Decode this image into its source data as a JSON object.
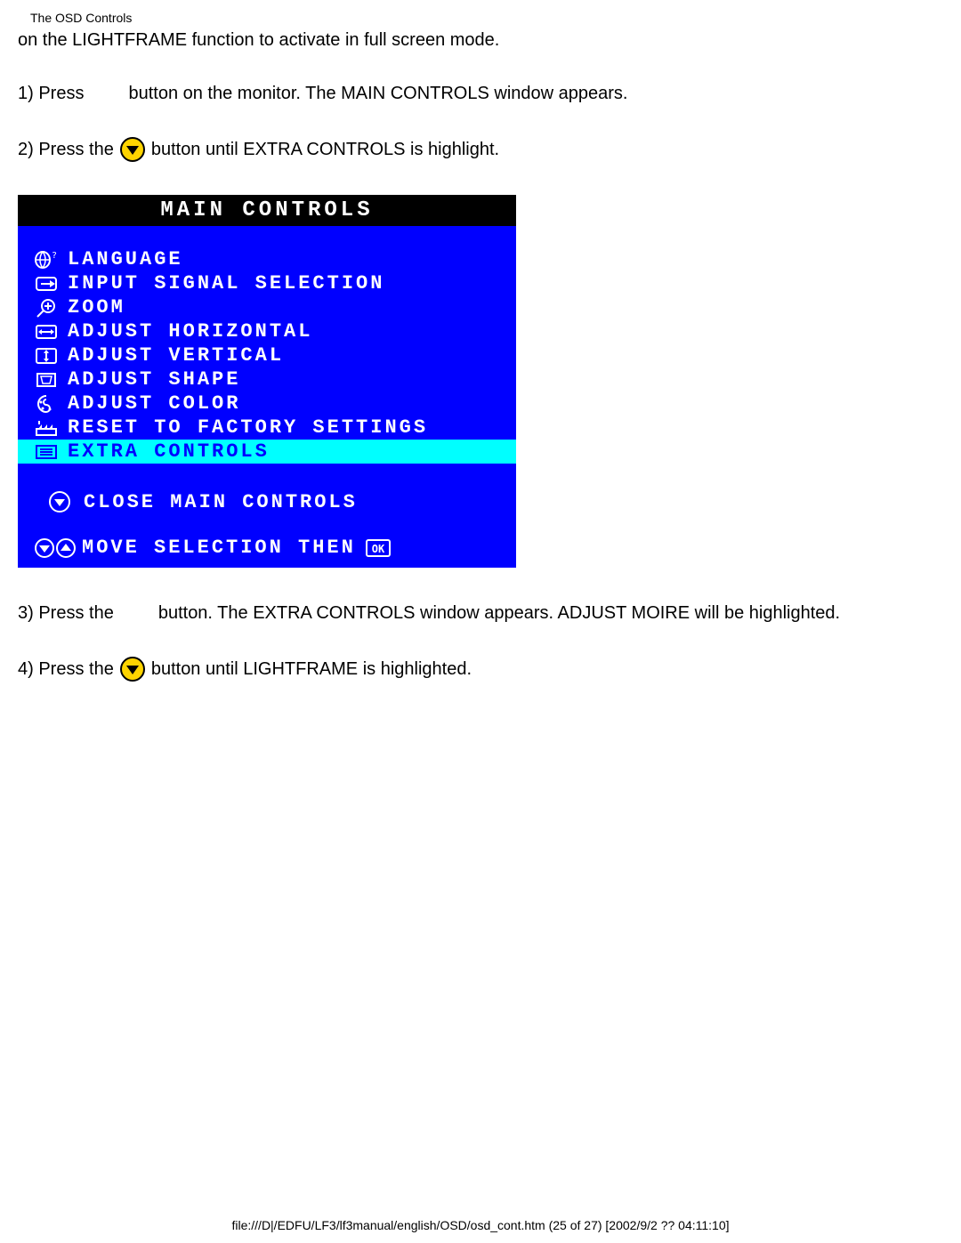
{
  "header": {
    "title": "The OSD Controls"
  },
  "intro": "on the LIGHTFRAME function to activate in full screen mode.",
  "steps": {
    "s1a": "1) Press",
    "s1b": "button on the monitor. The MAIN CONTROLS window appears.",
    "s2a": "2) Press the",
    "s2b": "button until EXTRA CONTROLS is highlight.",
    "s3a": "3) Press the",
    "s3b": "button. The EXTRA CONTROLS window appears. ADJUST MOIRE will be highlighted.",
    "s4a": "4) Press the",
    "s4b": "button until LIGHTFRAME is highlighted."
  },
  "osd": {
    "title": "MAIN CONTROLS",
    "items": [
      {
        "label": "LANGUAGE"
      },
      {
        "label": "INPUT SIGNAL SELECTION"
      },
      {
        "label": "ZOOM"
      },
      {
        "label": "ADJUST HORIZONTAL"
      },
      {
        "label": "ADJUST VERTICAL"
      },
      {
        "label": "ADJUST SHAPE"
      },
      {
        "label": "ADJUST COLOR"
      },
      {
        "label": "RESET TO FACTORY SETTINGS"
      },
      {
        "label": "EXTRA CONTROLS"
      }
    ],
    "close": "CLOSE MAIN CONTROLS",
    "foot": "MOVE SELECTION THEN",
    "ok": "OK"
  },
  "footer": "file:///D|/EDFU/LF3/lf3manual/english/OSD/osd_cont.htm (25 of 27) [2002/9/2 ?? 04:11:10]"
}
